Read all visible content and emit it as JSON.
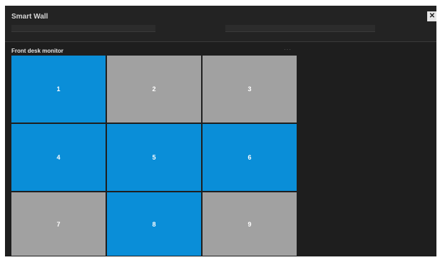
{
  "window": {
    "title": "Smart Wall",
    "close_icon": "close-icon"
  },
  "fields": {
    "left_value": "",
    "right_value": ""
  },
  "monitor": {
    "label": "Front desk monitor",
    "menu_label": "···"
  },
  "tiles": [
    {
      "label": "1",
      "state": "active"
    },
    {
      "label": "2",
      "state": "inactive"
    },
    {
      "label": "3",
      "state": "inactive"
    },
    {
      "label": "4",
      "state": "active"
    },
    {
      "label": "5",
      "state": "active"
    },
    {
      "label": "6",
      "state": "active"
    },
    {
      "label": "7",
      "state": "inactive"
    },
    {
      "label": "8",
      "state": "active"
    },
    {
      "label": "9",
      "state": "inactive"
    }
  ],
  "colors": {
    "active": "#0a8ed8",
    "inactive": "#a1a1a1",
    "background": "#1e1e1e"
  }
}
